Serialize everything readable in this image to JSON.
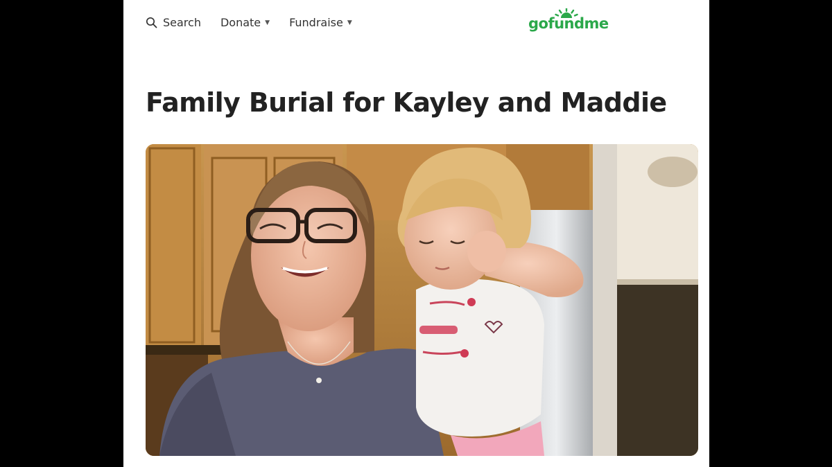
{
  "header": {
    "search_label": "Search",
    "donate_label": "Donate",
    "fundraise_label": "Fundraise",
    "logo_text": "gofundme",
    "brand_color": "#2ba84a"
  },
  "campaign": {
    "title": "Family Burial for Kayley and Maddie"
  },
  "icons": {
    "search": "search-icon",
    "caret": "chevron-down-icon",
    "logo": "gofundme-logo"
  }
}
